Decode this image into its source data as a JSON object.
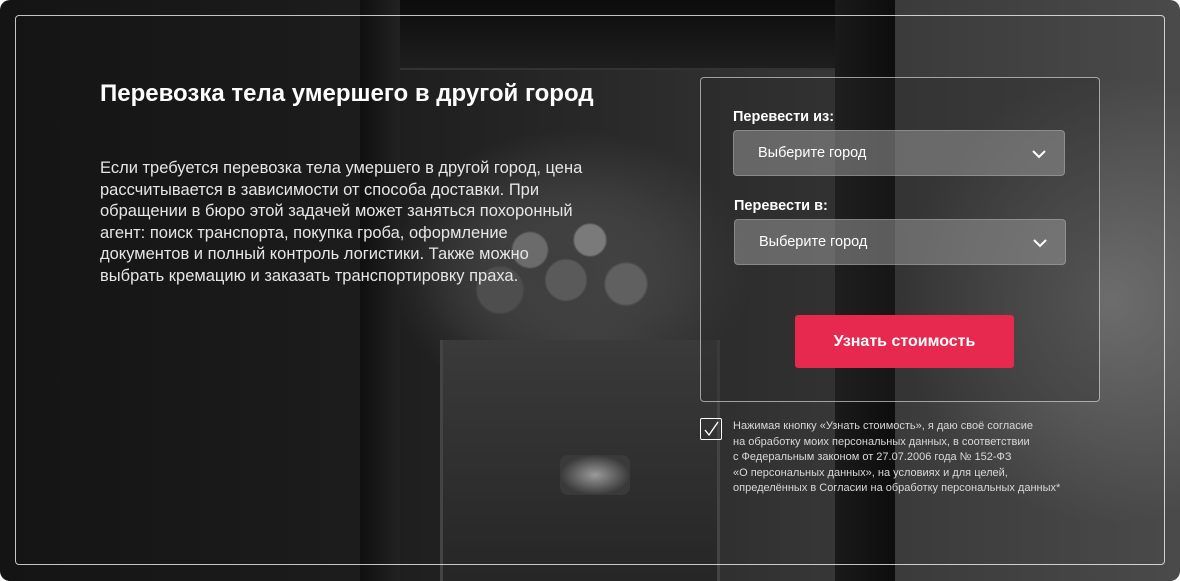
{
  "hero": {
    "title": "Перевозка тела умершего в другой город",
    "description": "Если требуется перевозка тела умершего в другой город, цена рассчитывается в зависимости от способа доставки. При обращении в бюро этой задачей может заняться похоронный агент: поиск транспорта, покупка гроба, оформление документов и полный контроль логистики. Также можно выбрать кремацию и заказать транспортировку праха."
  },
  "form": {
    "from_label": "Перевести из:",
    "from_value": "Выберите город",
    "to_label": "Перевести в:",
    "to_value": "Выберите город",
    "submit_label": "Узнать стоимость"
  },
  "consent": {
    "checked": true,
    "lines": [
      "Нажимая кнопку «Узнать стоимость», я даю своё согласие",
      "на обработку моих персональных данных, в соответствии",
      "с Федеральным законом от 27.07.2006 года № 152-ФЗ",
      "«О персональных данных», на условиях и для целей,",
      "определённых в Согласии на обработку персональных данных*"
    ]
  },
  "colors": {
    "accent": "#e8294f",
    "text": "#ffffff"
  },
  "icons": {
    "select_arrow": "chevron-down-icon",
    "checkbox_mark": "checkmark-icon"
  }
}
